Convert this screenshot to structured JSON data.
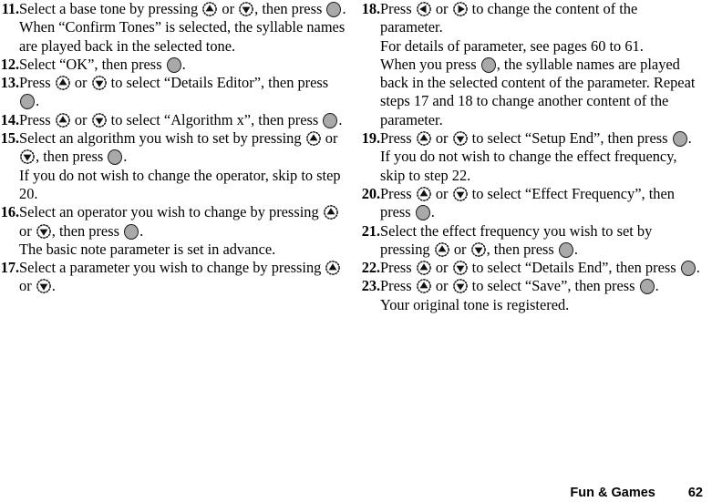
{
  "document": {
    "type": "instruction-manual-page",
    "footer": {
      "section": "Fun & Games",
      "page_number": "62"
    }
  },
  "icons": {
    "up": "nav-up-icon",
    "down": "nav-down-icon",
    "left": "nav-left-icon",
    "right": "nav-right-icon",
    "center": "center-key-icon"
  },
  "left_column": {
    "steps": [
      {
        "number": "11.",
        "paragraphs": [
          {
            "runs": [
              {
                "t": "text",
                "v": "Select a base tone by pressing "
              },
              {
                "t": "icon",
                "v": "up"
              },
              {
                "t": "text",
                "v": " or "
              },
              {
                "t": "icon",
                "v": "down"
              },
              {
                "t": "text",
                "v": ", then press "
              },
              {
                "t": "icon",
                "v": "center"
              },
              {
                "t": "text",
                "v": "."
              }
            ]
          },
          {
            "runs": [
              {
                "t": "text",
                "v": "When “Confirm Tones” is selected, the syllable names are played back in the selected tone."
              }
            ]
          }
        ]
      },
      {
        "number": "12.",
        "paragraphs": [
          {
            "runs": [
              {
                "t": "text",
                "v": "Select “OK”, then press "
              },
              {
                "t": "icon",
                "v": "center"
              },
              {
                "t": "text",
                "v": "."
              }
            ]
          }
        ]
      },
      {
        "number": "13.",
        "paragraphs": [
          {
            "runs": [
              {
                "t": "text",
                "v": "Press "
              },
              {
                "t": "icon",
                "v": "up"
              },
              {
                "t": "text",
                "v": " or "
              },
              {
                "t": "icon",
                "v": "down"
              },
              {
                "t": "text",
                "v": " to select “Details Editor”, then press "
              },
              {
                "t": "icon",
                "v": "center"
              },
              {
                "t": "text",
                "v": "."
              }
            ]
          }
        ]
      },
      {
        "number": "14.",
        "paragraphs": [
          {
            "runs": [
              {
                "t": "text",
                "v": "Press "
              },
              {
                "t": "icon",
                "v": "up"
              },
              {
                "t": "text",
                "v": " or "
              },
              {
                "t": "icon",
                "v": "down"
              },
              {
                "t": "text",
                "v": " to select “Algorithm x”, then press "
              },
              {
                "t": "icon",
                "v": "center"
              },
              {
                "t": "text",
                "v": "."
              }
            ]
          }
        ]
      },
      {
        "number": "15.",
        "paragraphs": [
          {
            "runs": [
              {
                "t": "text",
                "v": "Select an algorithm you wish to set by pressing "
              },
              {
                "t": "icon",
                "v": "up"
              },
              {
                "t": "text",
                "v": " or "
              },
              {
                "t": "icon",
                "v": "down"
              },
              {
                "t": "text",
                "v": ", then press "
              },
              {
                "t": "icon",
                "v": "center"
              },
              {
                "t": "text",
                "v": "."
              }
            ]
          },
          {
            "runs": [
              {
                "t": "text",
                "v": "If you do not wish to change the operator, skip to step 20."
              }
            ]
          }
        ]
      },
      {
        "number": "16.",
        "paragraphs": [
          {
            "runs": [
              {
                "t": "text",
                "v": "Select an operator you wish to change by pressing "
              },
              {
                "t": "icon",
                "v": "up"
              },
              {
                "t": "text",
                "v": " or "
              },
              {
                "t": "icon",
                "v": "down"
              },
              {
                "t": "text",
                "v": ", then press "
              },
              {
                "t": "icon",
                "v": "center"
              },
              {
                "t": "text",
                "v": "."
              }
            ]
          },
          {
            "runs": [
              {
                "t": "text",
                "v": "The basic note parameter is set in advance."
              }
            ]
          }
        ]
      },
      {
        "number": "17.",
        "paragraphs": [
          {
            "runs": [
              {
                "t": "text",
                "v": "Select a parameter you wish to change by pressing "
              },
              {
                "t": "icon",
                "v": "up"
              },
              {
                "t": "text",
                "v": " or "
              },
              {
                "t": "icon",
                "v": "down"
              },
              {
                "t": "text",
                "v": "."
              }
            ]
          }
        ]
      }
    ]
  },
  "right_column": {
    "steps": [
      {
        "number": "18.",
        "paragraphs": [
          {
            "runs": [
              {
                "t": "text",
                "v": "Press "
              },
              {
                "t": "icon",
                "v": "left"
              },
              {
                "t": "text",
                "v": " or "
              },
              {
                "t": "icon",
                "v": "right"
              },
              {
                "t": "text",
                "v": " to change the content of the parameter."
              }
            ]
          },
          {
            "runs": [
              {
                "t": "text",
                "v": "For details of parameter, see pages 60 to 61."
              }
            ]
          },
          {
            "runs": [
              {
                "t": "text",
                "v": "When you press "
              },
              {
                "t": "icon",
                "v": "center"
              },
              {
                "t": "text",
                "v": ", the syllable names are played back in the selected content of the parameter. Repeat steps 17 and 18 to change another content of the parameter."
              }
            ]
          }
        ]
      },
      {
        "number": "19.",
        "paragraphs": [
          {
            "runs": [
              {
                "t": "text",
                "v": "Press "
              },
              {
                "t": "icon",
                "v": "up"
              },
              {
                "t": "text",
                "v": " or "
              },
              {
                "t": "icon",
                "v": "down"
              },
              {
                "t": "text",
                "v": " to select “Setup End”, then press "
              },
              {
                "t": "icon",
                "v": "center"
              },
              {
                "t": "text",
                "v": "."
              }
            ]
          },
          {
            "runs": [
              {
                "t": "text",
                "v": "If you do not wish to change the effect frequency, skip to step 22."
              }
            ]
          }
        ]
      },
      {
        "number": "20.",
        "paragraphs": [
          {
            "runs": [
              {
                "t": "text",
                "v": "Press "
              },
              {
                "t": "icon",
                "v": "up"
              },
              {
                "t": "text",
                "v": " or "
              },
              {
                "t": "icon",
                "v": "down"
              },
              {
                "t": "text",
                "v": " to select “Effect Frequency”, then press "
              },
              {
                "t": "icon",
                "v": "center"
              },
              {
                "t": "text",
                "v": "."
              }
            ]
          }
        ]
      },
      {
        "number": "21.",
        "paragraphs": [
          {
            "runs": [
              {
                "t": "text",
                "v": "Select the effect frequency you wish to set by pressing "
              },
              {
                "t": "icon",
                "v": "up"
              },
              {
                "t": "text",
                "v": " or "
              },
              {
                "t": "icon",
                "v": "down"
              },
              {
                "t": "text",
                "v": ", then press "
              },
              {
                "t": "icon",
                "v": "center"
              },
              {
                "t": "text",
                "v": "."
              }
            ]
          }
        ]
      },
      {
        "number": "22.",
        "paragraphs": [
          {
            "runs": [
              {
                "t": "text",
                "v": "Press "
              },
              {
                "t": "icon",
                "v": "up"
              },
              {
                "t": "text",
                "v": " or "
              },
              {
                "t": "icon",
                "v": "down"
              },
              {
                "t": "text",
                "v": " to select “Details End”, then press "
              },
              {
                "t": "icon",
                "v": "center"
              },
              {
                "t": "text",
                "v": "."
              }
            ]
          }
        ]
      },
      {
        "number": "23.",
        "paragraphs": [
          {
            "runs": [
              {
                "t": "text",
                "v": "Press "
              },
              {
                "t": "icon",
                "v": "up"
              },
              {
                "t": "text",
                "v": " or "
              },
              {
                "t": "icon",
                "v": "down"
              },
              {
                "t": "text",
                "v": " to select “Save”, then press "
              },
              {
                "t": "icon",
                "v": "center"
              },
              {
                "t": "text",
                "v": "."
              }
            ]
          },
          {
            "runs": [
              {
                "t": "text",
                "v": "Your original tone is registered."
              }
            ]
          }
        ]
      }
    ]
  }
}
